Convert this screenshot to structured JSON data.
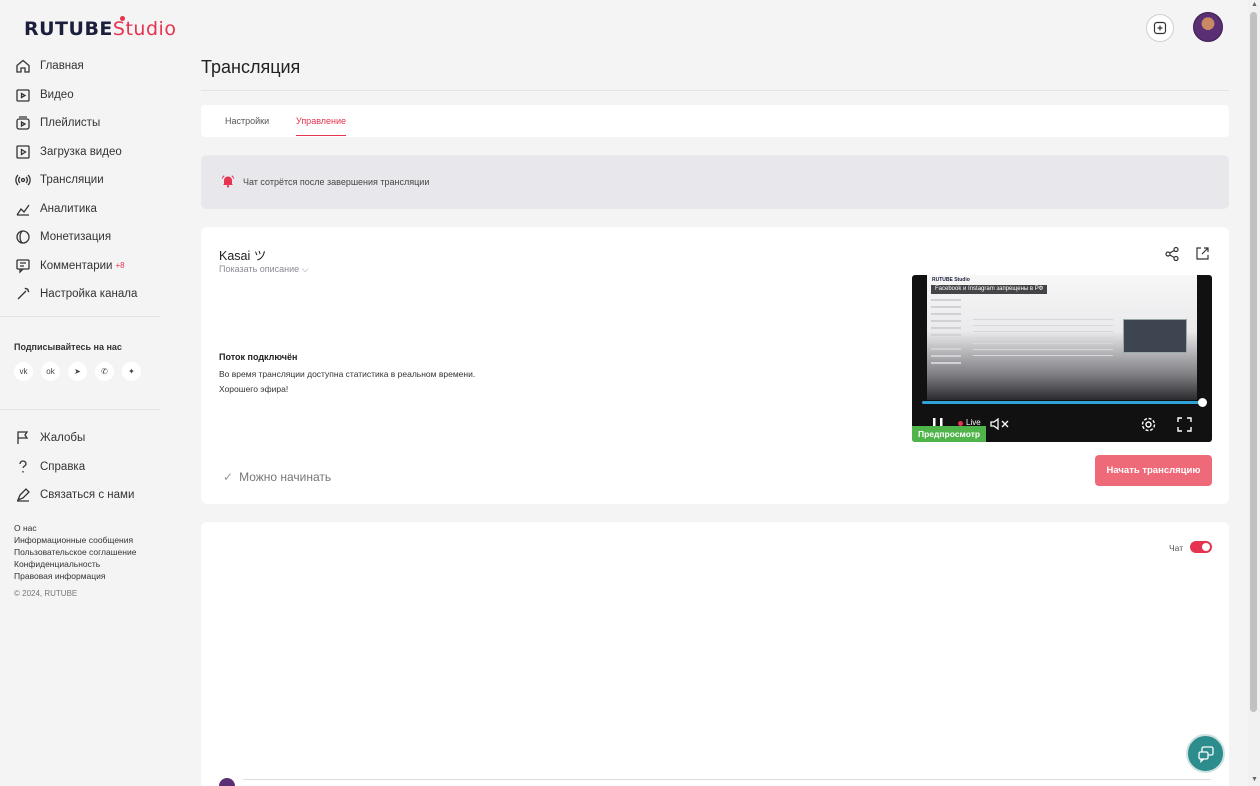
{
  "brand": {
    "name": "RUTUBE",
    "suffix": "Studio",
    "accent": "#e6334f"
  },
  "sidebar": {
    "items": [
      {
        "label": "Главная",
        "icon": "home-icon"
      },
      {
        "label": "Видео",
        "icon": "video-icon"
      },
      {
        "label": "Плейлисты",
        "icon": "playlist-icon"
      },
      {
        "label": "Загрузка видео",
        "icon": "upload-icon"
      },
      {
        "label": "Трансляции",
        "icon": "broadcast-icon"
      },
      {
        "label": "Аналитика",
        "icon": "analytics-icon"
      },
      {
        "label": "Монетизация",
        "icon": "coin-icon"
      },
      {
        "label": "Комментарии",
        "icon": "comments-icon",
        "badge": "+8"
      },
      {
        "label": "Настройка канала",
        "icon": "magic-wand-icon"
      }
    ],
    "follow_title": "Подписывайтесь на нас",
    "socials": [
      "vk-icon",
      "ok-icon",
      "telegram-icon",
      "viber-icon",
      "plus-icon"
    ],
    "support": [
      {
        "label": "Жалобы",
        "icon": "flag-icon"
      },
      {
        "label": "Справка",
        "icon": "question-icon"
      },
      {
        "label": "Связаться с нами",
        "icon": "contact-icon"
      }
    ],
    "footer_links": [
      "О нас",
      "Информационные сообщения",
      "Пользовательское соглашение",
      "Конфиденциальность",
      "Правовая информация"
    ],
    "copyright": "© 2024, RUTUBE"
  },
  "header": {
    "title": "Трансляция"
  },
  "tabs": [
    {
      "label": "Настройки",
      "active": false
    },
    {
      "label": "Управление",
      "active": true
    }
  ],
  "notice": {
    "text": "Чат сотрётся после завершения трансляции"
  },
  "stream": {
    "name": "Kasai ツ",
    "show_description": "Показать описание",
    "status_title": "Поток подключён",
    "status_line1": "Во время трансляции доступна статистика в реальном времени.",
    "status_line2": "Хорошего эфира!",
    "ready_text": "Можно начинать",
    "start_button": "Начать трансляцию",
    "preview": {
      "banner": "Facebook и Instagram запрещены в РФ",
      "mini_logo": "RUTUBE Studio",
      "live_label": "Live",
      "preview_label": "Предпросмотр",
      "progress": 1.0
    }
  },
  "chat": {
    "label": "Чат",
    "enabled": true
  }
}
